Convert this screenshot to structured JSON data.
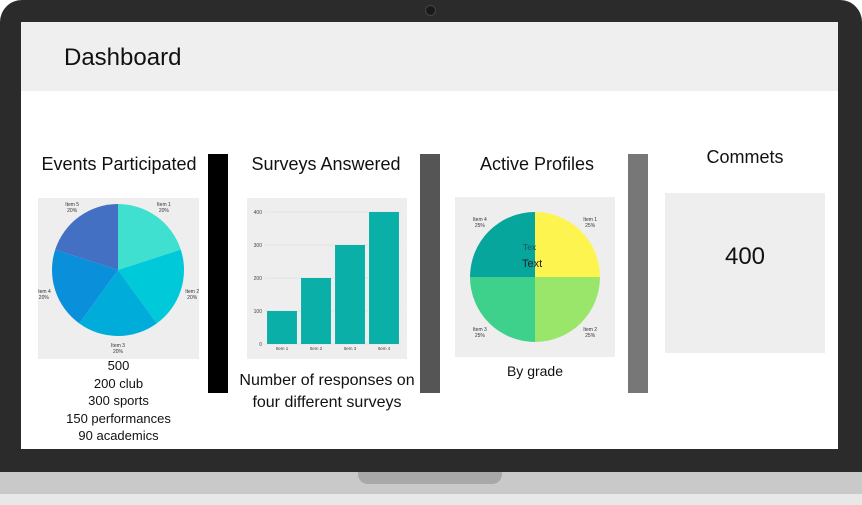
{
  "header": {
    "title": "Dashboard"
  },
  "events": {
    "title": "Events Participated",
    "stats": [
      "500",
      "200 club",
      "300 sports",
      "150 performances",
      "90 academics"
    ],
    "pie": [
      {
        "label": "Item 1",
        "pct": "20%",
        "value": 20,
        "color": "#3fe0d0"
      },
      {
        "label": "Item 2",
        "pct": "20%",
        "value": 20,
        "color": "#00c9d9"
      },
      {
        "label": "Item 3",
        "pct": "20%",
        "value": 20,
        "color": "#00acd9"
      },
      {
        "label": "Item 4",
        "pct": "20%",
        "value": 20,
        "color": "#0a8fdb"
      },
      {
        "label": "Item 5",
        "pct": "20%",
        "value": 20,
        "color": "#4470c4"
      }
    ]
  },
  "surveys": {
    "title": "Surveys Answered",
    "caption_line1": "Number of responses on",
    "caption_line2": "four different surveys",
    "bar_color": "#0aafa8"
  },
  "profiles": {
    "title": "Active Profiles",
    "caption": "By grade",
    "overlay_text": "Text",
    "overlay_fragment": "Tex",
    "pie": [
      {
        "label": "Item 1",
        "pct": "25%",
        "value": 25,
        "color": "#fdf44f"
      },
      {
        "label": "Item 2",
        "pct": "25%",
        "value": 25,
        "color": "#9ae66a"
      },
      {
        "label": "Item 3",
        "pct": "25%",
        "value": 25,
        "color": "#3dd18b"
      },
      {
        "label": "Item 4",
        "pct": "25%",
        "value": 25,
        "color": "#06a69c"
      }
    ]
  },
  "comments": {
    "title": "Commets",
    "value": "400"
  },
  "colors": {
    "header_bg": "#efefef",
    "divider_1": "#000000",
    "divider_2": "#555555",
    "divider_3": "#777777"
  },
  "chart_data": {
    "type": "bar",
    "categories": [
      "Item 1",
      "Item 2",
      "Item 3",
      "Item 4"
    ],
    "values": [
      100,
      200,
      300,
      400
    ],
    "yticks": [
      "0",
      "100",
      "200",
      "300",
      "400"
    ],
    "ylim": [
      0,
      400
    ],
    "grid": true
  }
}
